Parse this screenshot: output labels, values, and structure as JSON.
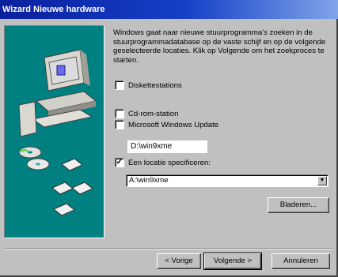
{
  "window": {
    "title": "Wizard Nieuwe hardware"
  },
  "intro_text": "Windows gaat naar nieuwe stuurprogramma's zoeken in de stuurprogrammadatabase op de vaste schijf en op de volgende geselecteerde locaties. Klik op Volgende om het zoekproces te starten.",
  "options": {
    "floppy": {
      "label": "Diskettestations",
      "checked": false
    },
    "cdrom": {
      "label": "Cd-rom-station",
      "checked": false
    },
    "windows_update": {
      "label": "Microsoft Windows Update",
      "checked": false
    },
    "drive_value": "D:\\win9xme",
    "specify_location": {
      "label": "Een locatie specificeren:",
      "checked": true
    }
  },
  "location_combo": {
    "value": "A:\\win9xme"
  },
  "buttons": {
    "browse": "Bladeren...",
    "back": "< Vorige",
    "next": "Volgende >",
    "cancel": "Annuleren"
  },
  "colors": {
    "title_bar": "#0a1f9e",
    "illustration_bg": "#008080",
    "face": "#c0c0c0"
  }
}
